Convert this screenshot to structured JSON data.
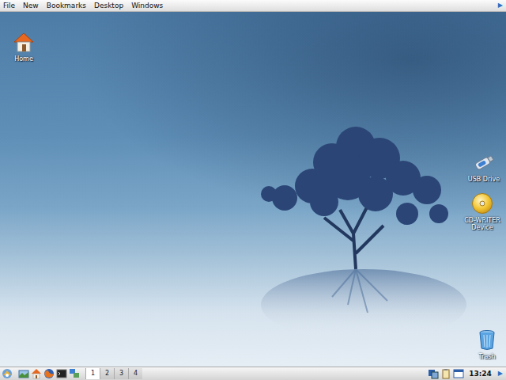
{
  "menubar": {
    "items": [
      "File",
      "New",
      "Bookmarks",
      "Desktop",
      "Windows"
    ],
    "expand": "▶"
  },
  "desktop_icons": [
    {
      "label": "Home",
      "kind": "home"
    },
    {
      "label": "USB Drive",
      "kind": "usb"
    },
    {
      "label": "CD-WRITER Device",
      "kind": "cd"
    },
    {
      "label": "Trash",
      "kind": "trash"
    }
  ],
  "taskbar": {
    "workspaces": [
      {
        "label": "1",
        "selected": true
      },
      {
        "label": "2",
        "selected": false
      },
      {
        "label": "3",
        "selected": false
      },
      {
        "label": "4",
        "selected": false
      }
    ],
    "clock": "13:24",
    "expand": "▶"
  }
}
